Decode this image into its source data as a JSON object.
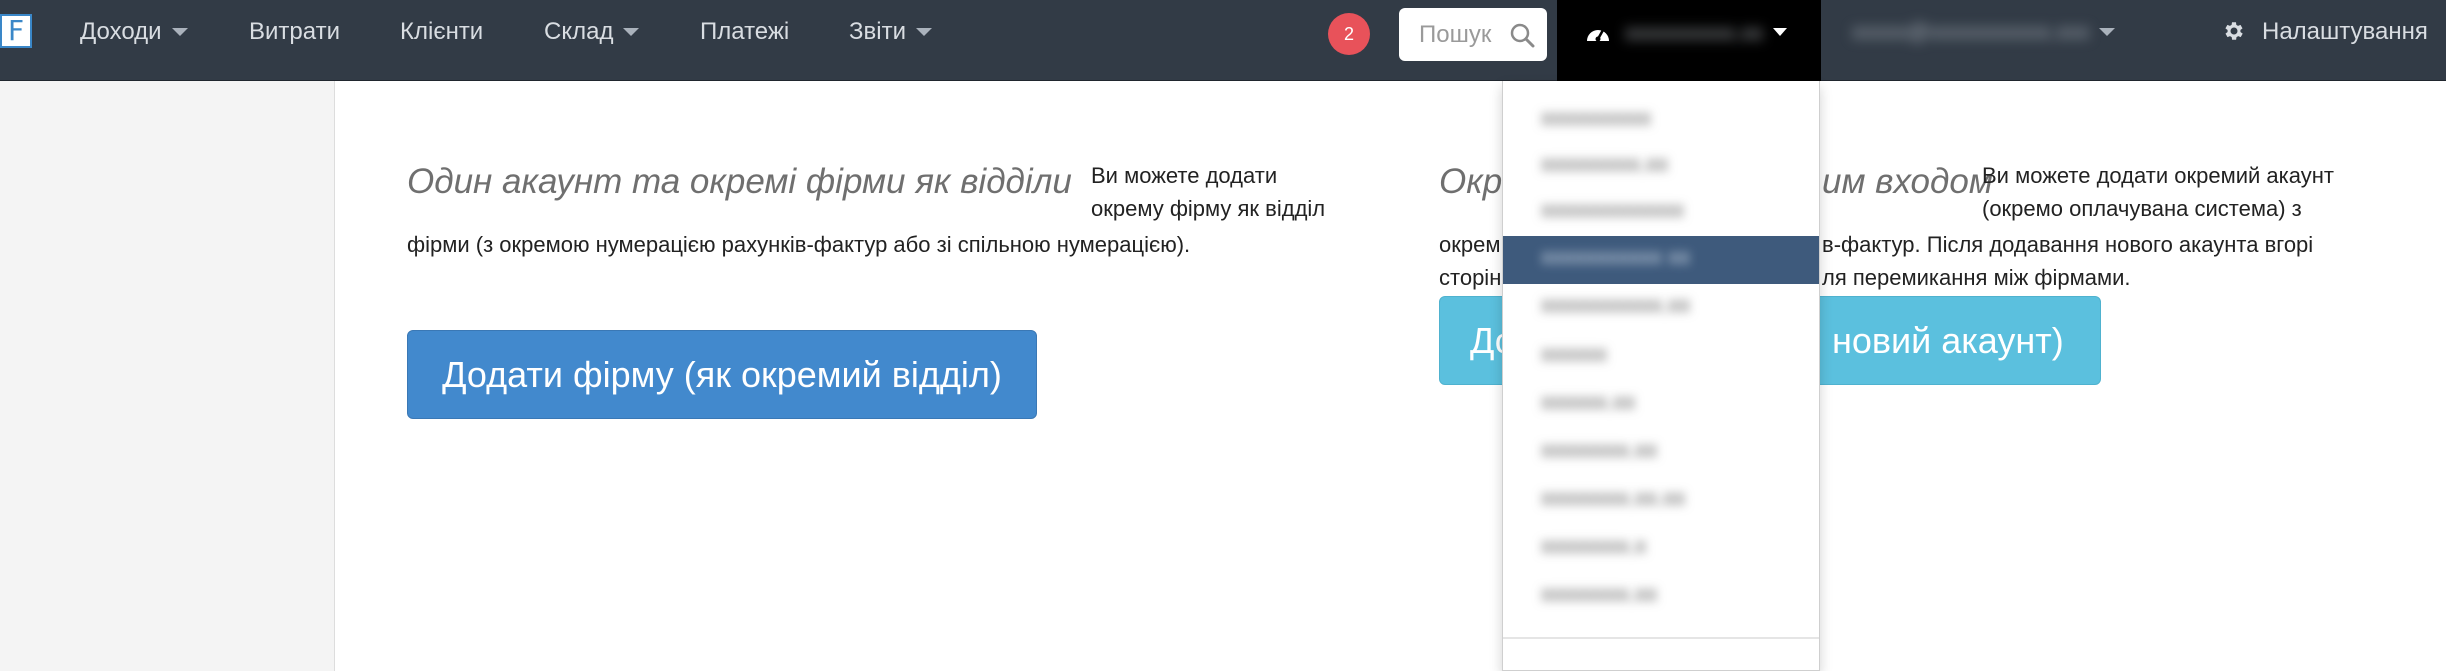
{
  "navbar": {
    "logo_letter": "F",
    "items": [
      {
        "label": "Доходи",
        "has_caret": true
      },
      {
        "label": "Витрати",
        "has_caret": false
      },
      {
        "label": "Клієнти",
        "has_caret": false
      },
      {
        "label": "Склад",
        "has_caret": true
      },
      {
        "label": "Платежі",
        "has_caret": false
      },
      {
        "label": "Звіти",
        "has_caret": true
      }
    ],
    "notification_count": "2",
    "search_placeholder": "Пошук",
    "company_switcher_label": "xxxxxxxxxx.xx",
    "user_email": "xxxxx@xxxxxxxxxxx.xxx",
    "settings_label": "Налаштування",
    "bg_color": "#323b46",
    "badge_color": "#e8525a"
  },
  "left_section": {
    "heading": "Один акаунт та окремі фірми як відділи",
    "text_right_line1": "Ви можете додати",
    "text_right_line2": "окрему фірму як відділ",
    "text_continuation": "фірми (з окремою нумерацією рахунків-фактур або зі спільною нумерацією).",
    "button_label": "Додати фірму (як окремий відділ)",
    "button_color": "#4289cd"
  },
  "right_section": {
    "heading_start": "Окр",
    "heading_end": "им входом",
    "text_line1": "Ви можете додати окремий акаунт",
    "text_line2": "(окремо оплачувана система) з",
    "text_line3_start": "окрем",
    "text_line3_end": "в-фактур. Після додавання нового акаунта вгорі",
    "text_line4_start": "сторін",
    "text_line4_end": "ля перемикання між фірмами.",
    "button_label_start": "До",
    "button_label_end": "новий акаунт)",
    "button_color": "#5bc0de"
  },
  "dropdown": {
    "items": [
      {
        "label": "xxxxxxxxxx",
        "active": false
      },
      {
        "label": "xxxxxxxxx.xx",
        "active": false
      },
      {
        "label": "xxxxxxxxxxxxx",
        "active": false
      },
      {
        "label": "xxxxxxxxxxx xx",
        "active": true
      },
      {
        "label": "xxxxxxxxxxx.xx",
        "active": false
      },
      {
        "label": "xxxxxx",
        "active": false
      },
      {
        "label": "xxxxxx.xx",
        "active": false
      },
      {
        "label": "xxxxxxxx.xx",
        "active": false
      },
      {
        "label": "xxxxxxxx.xx.xx",
        "active": false
      },
      {
        "label": "xxxxxxxx.x",
        "active": false
      },
      {
        "label": "xxxxxxxx.xx",
        "active": false
      }
    ],
    "active_color": "#3e5a7c"
  }
}
